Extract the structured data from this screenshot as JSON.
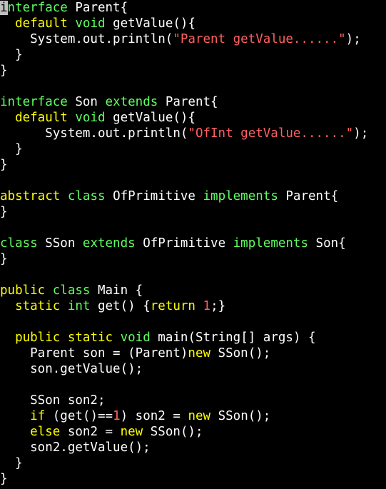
{
  "colors": {
    "background": "#000000",
    "plain": "#ffffff",
    "keyword": "#60ff60",
    "type": "#ffff00",
    "string": "#ff6060",
    "number": "#ff6060",
    "cursor_bg": "#c0c0c0",
    "cursor_fg": "#000000"
  },
  "editor": {
    "lines": [
      [
        {
          "t": "i",
          "k": "cursor"
        },
        {
          "t": "nterface",
          "k": "keyword"
        },
        {
          "t": " Parent{",
          "k": "plain"
        }
      ],
      [
        {
          "t": "  ",
          "k": "plain"
        },
        {
          "t": "default",
          "k": "type"
        },
        {
          "t": " ",
          "k": "plain"
        },
        {
          "t": "void",
          "k": "keyword"
        },
        {
          "t": " getValue(){",
          "k": "plain"
        }
      ],
      [
        {
          "t": "    System.out.println(",
          "k": "plain"
        },
        {
          "t": "\"Parent getValue......\"",
          "k": "string"
        },
        {
          "t": ");",
          "k": "plain"
        }
      ],
      [
        {
          "t": "  }",
          "k": "plain"
        }
      ],
      [
        {
          "t": "}",
          "k": "plain"
        }
      ],
      [],
      [
        {
          "t": "interface",
          "k": "keyword"
        },
        {
          "t": " Son ",
          "k": "plain"
        },
        {
          "t": "extends",
          "k": "keyword"
        },
        {
          "t": " Parent{",
          "k": "plain"
        }
      ],
      [
        {
          "t": "  ",
          "k": "plain"
        },
        {
          "t": "default",
          "k": "type"
        },
        {
          "t": " ",
          "k": "plain"
        },
        {
          "t": "void",
          "k": "keyword"
        },
        {
          "t": " getValue(){",
          "k": "plain"
        }
      ],
      [
        {
          "t": "      System.out.println(",
          "k": "plain"
        },
        {
          "t": "\"OfInt getValue......\"",
          "k": "string"
        },
        {
          "t": ");",
          "k": "plain"
        }
      ],
      [
        {
          "t": "  }",
          "k": "plain"
        }
      ],
      [
        {
          "t": "}",
          "k": "plain"
        }
      ],
      [],
      [
        {
          "t": "abstract",
          "k": "type"
        },
        {
          "t": " ",
          "k": "plain"
        },
        {
          "t": "class",
          "k": "keyword"
        },
        {
          "t": " OfPrimitive ",
          "k": "plain"
        },
        {
          "t": "implements",
          "k": "keyword"
        },
        {
          "t": " Parent{",
          "k": "plain"
        }
      ],
      [
        {
          "t": "}",
          "k": "plain"
        }
      ],
      [],
      [
        {
          "t": "class",
          "k": "keyword"
        },
        {
          "t": " SSon ",
          "k": "plain"
        },
        {
          "t": "extends",
          "k": "keyword"
        },
        {
          "t": " OfPrimitive ",
          "k": "plain"
        },
        {
          "t": "implements",
          "k": "keyword"
        },
        {
          "t": " Son{",
          "k": "plain"
        }
      ],
      [
        {
          "t": "}",
          "k": "plain"
        }
      ],
      [],
      [
        {
          "t": "public",
          "k": "type"
        },
        {
          "t": " ",
          "k": "plain"
        },
        {
          "t": "class",
          "k": "keyword"
        },
        {
          "t": " Main {",
          "k": "plain"
        }
      ],
      [
        {
          "t": "  ",
          "k": "plain"
        },
        {
          "t": "static",
          "k": "type"
        },
        {
          "t": " ",
          "k": "plain"
        },
        {
          "t": "int",
          "k": "keyword"
        },
        {
          "t": " get() {",
          "k": "plain"
        },
        {
          "t": "return",
          "k": "type"
        },
        {
          "t": " ",
          "k": "plain"
        },
        {
          "t": "1",
          "k": "number"
        },
        {
          "t": ";}",
          "k": "plain"
        }
      ],
      [],
      [
        {
          "t": "  ",
          "k": "plain"
        },
        {
          "t": "public",
          "k": "type"
        },
        {
          "t": " ",
          "k": "plain"
        },
        {
          "t": "static",
          "k": "type"
        },
        {
          "t": " ",
          "k": "plain"
        },
        {
          "t": "void",
          "k": "keyword"
        },
        {
          "t": " main(String[] args) {",
          "k": "plain"
        }
      ],
      [
        {
          "t": "    Parent son = (Parent)",
          "k": "plain"
        },
        {
          "t": "new",
          "k": "type"
        },
        {
          "t": " SSon();",
          "k": "plain"
        }
      ],
      [
        {
          "t": "    son.getValue();",
          "k": "plain"
        }
      ],
      [],
      [
        {
          "t": "    SSon son2;",
          "k": "plain"
        }
      ],
      [
        {
          "t": "    ",
          "k": "plain"
        },
        {
          "t": "if",
          "k": "type"
        },
        {
          "t": " (get()==",
          "k": "plain"
        },
        {
          "t": "1",
          "k": "number"
        },
        {
          "t": ") son2 = ",
          "k": "plain"
        },
        {
          "t": "new",
          "k": "type"
        },
        {
          "t": " SSon();",
          "k": "plain"
        }
      ],
      [
        {
          "t": "    ",
          "k": "plain"
        },
        {
          "t": "else",
          "k": "type"
        },
        {
          "t": " son2 = ",
          "k": "plain"
        },
        {
          "t": "new",
          "k": "type"
        },
        {
          "t": " SSon();",
          "k": "plain"
        }
      ],
      [
        {
          "t": "    son2.getValue();",
          "k": "plain"
        }
      ],
      [
        {
          "t": "  }",
          "k": "plain"
        }
      ],
      [
        {
          "t": "}",
          "k": "plain"
        }
      ]
    ]
  }
}
